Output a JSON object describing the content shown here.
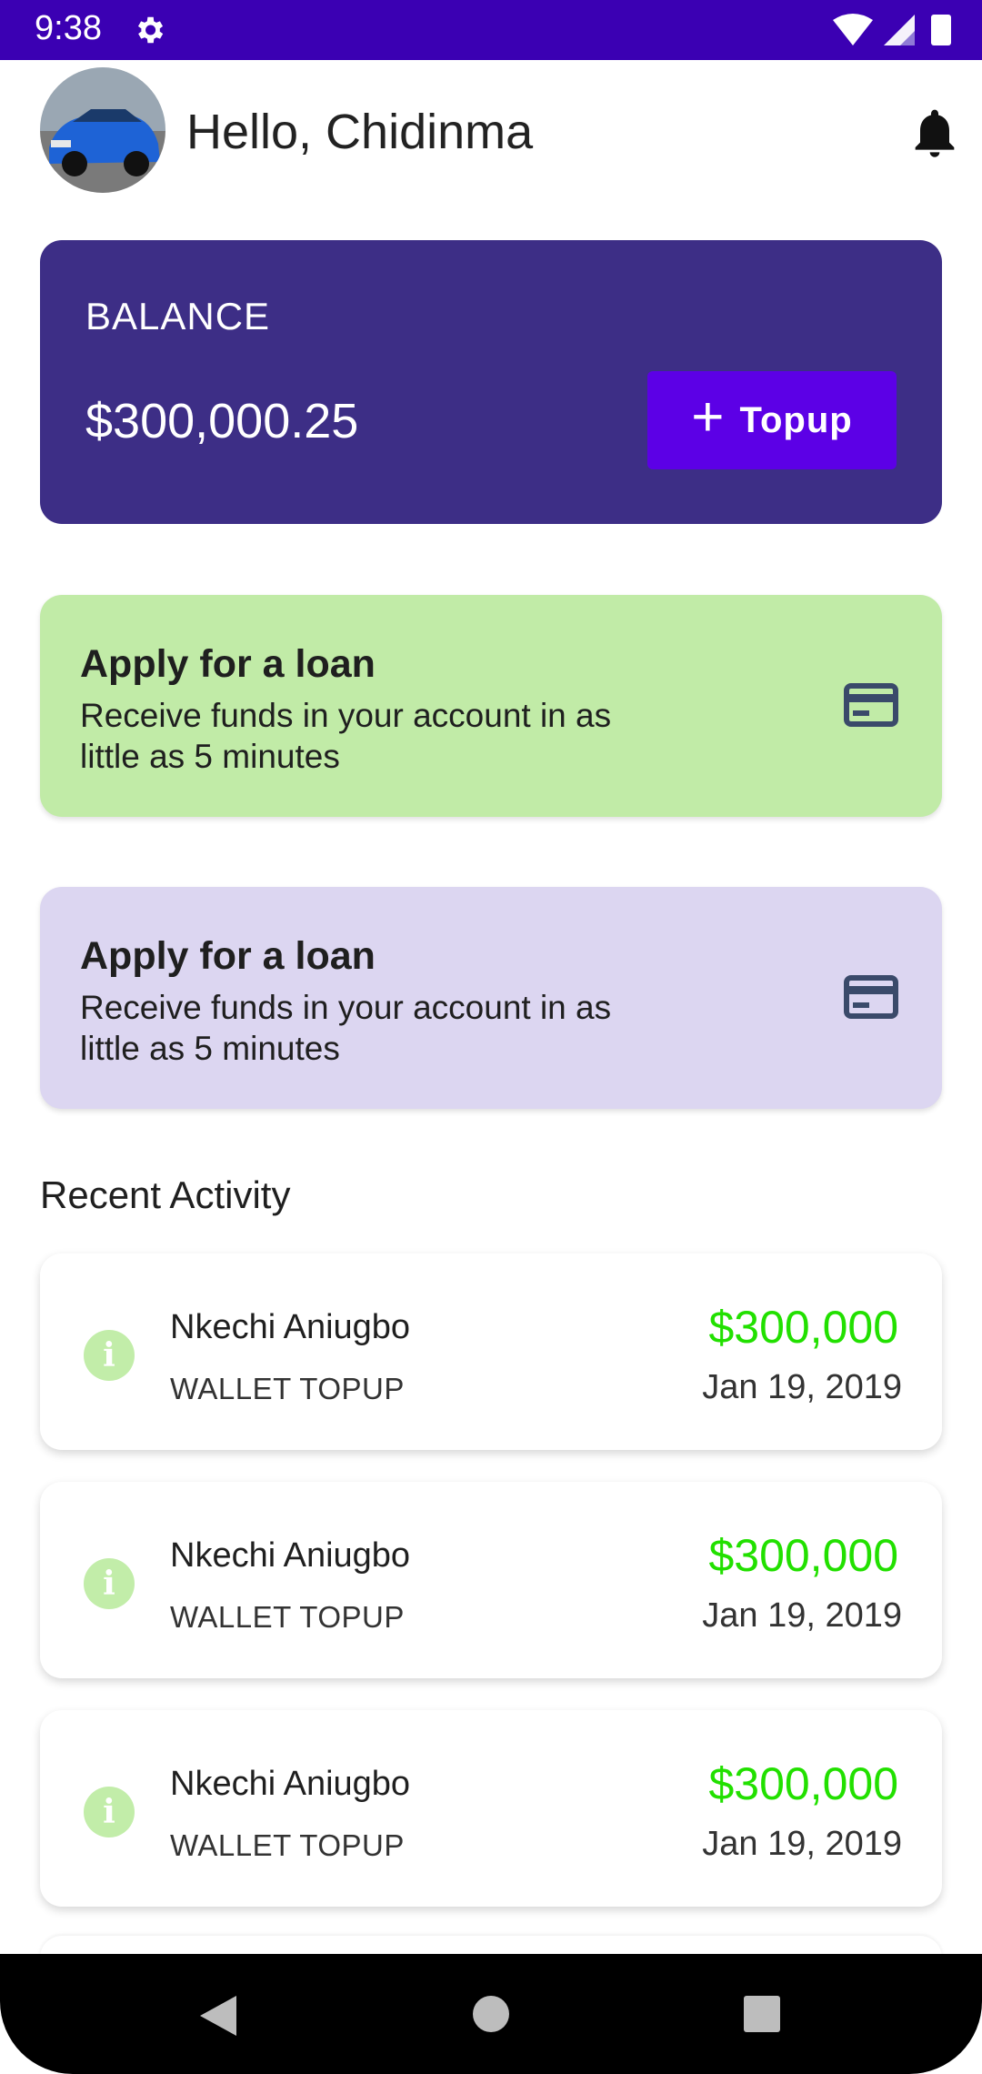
{
  "status_bar": {
    "time": "9:38"
  },
  "header": {
    "greeting": "Hello, Chidinma"
  },
  "balance": {
    "label": "BALANCE",
    "amount": "$300,000.25",
    "topup_label": "Topup"
  },
  "loan_cards": [
    {
      "title": "Apply for a loan",
      "description": "Receive funds in your account in as little as 5 minutes"
    },
    {
      "title": "Apply for a loan",
      "description": "Receive funds in your account in as little as 5 minutes"
    }
  ],
  "recent": {
    "title": "Recent Activity",
    "items": [
      {
        "name": "Nkechi Aniugbo",
        "type": "WALLET TOPUP",
        "amount": "$300,000",
        "date": "Jan 19, 2019"
      },
      {
        "name": "Nkechi Aniugbo",
        "type": "WALLET TOPUP",
        "amount": "$300,000",
        "date": "Jan 19, 2019"
      },
      {
        "name": "Nkechi Aniugbo",
        "type": "WALLET TOPUP",
        "amount": "$300,000",
        "date": "Jan 19, 2019"
      }
    ]
  },
  "icons": {
    "status": [
      "gear-icon",
      "wifi-icon",
      "signal-icon",
      "battery-icon"
    ],
    "header": [
      "avatar",
      "bell-icon"
    ],
    "loan": "credit-card-icon",
    "activity": "info-icon",
    "nav": [
      "back-icon",
      "home-icon",
      "recents-icon"
    ]
  },
  "colors": {
    "status_bar": "#3b00b3",
    "balance_card": "#3d2e86",
    "topup_button": "#5c00e6",
    "loan_green": "#c1eba7",
    "loan_purple": "#dcd6f1",
    "amount_green": "#22e000"
  }
}
